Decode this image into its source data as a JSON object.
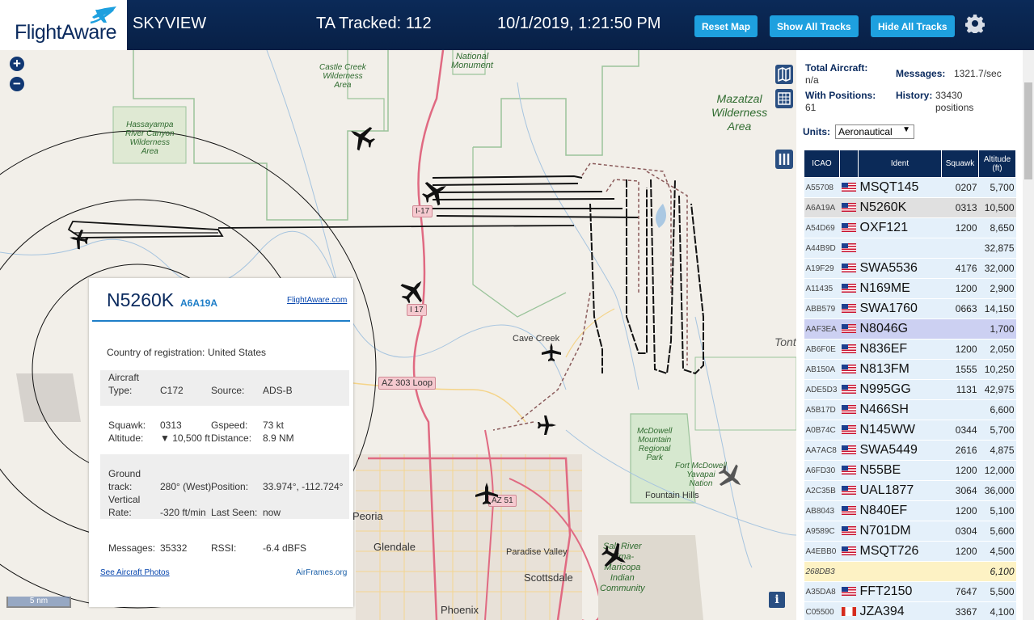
{
  "header": {
    "logo": "FlightAware",
    "title": "SKYVIEW",
    "tracked": "TA Tracked: 112",
    "datetime": "10/1/2019, 1:21:50 PM",
    "buttons": {
      "reset": "Reset Map",
      "show_all": "Show All Tracks",
      "hide_all": "Hide All Tracks"
    }
  },
  "map": {
    "labels": {
      "castle_creek": "Castle Creek\nWilderness\nArea",
      "hassayampa": "Hassayampa\nRiver Canyon\nWilderness\nArea",
      "national_monument": "National\nMonument",
      "mazatzal": "Mazatzal\nWilderness\nArea",
      "cave_creek": "Cave Creek",
      "mcdowell": "McDowell\nMountain\nRegional\nPark",
      "fort_mcdowell": "Fort McDowell\nYavapai\nNation",
      "fountain_hills": "Fountain Hills",
      "peoria": "Peoria",
      "glendale": "Glendale",
      "paradise_valley": "Paradise Valley",
      "scottsdale": "Scottsdale",
      "phoenix": "Phoenix",
      "salt_river": "Salt River\nPima-\nMaricopa\nIndian\nCommunity",
      "tonto": "Tont"
    },
    "roads": {
      "i17_top": "I-17",
      "i17": "I 17",
      "az303": "AZ 303 Loop",
      "az51": "AZ 51"
    },
    "scale": "5 nm",
    "info": "i"
  },
  "popup": {
    "ident": "N5260K",
    "icao": "A6A19A",
    "link": "FlightAware.com",
    "country_label": "Country of registration:",
    "country": "United States",
    "aircraft_type_label": "Aircraft\nType:",
    "aircraft_type": "C172",
    "source_label": "Source:",
    "source": "ADS-B",
    "squawk_label": "Squawk:",
    "squawk": "0313",
    "altitude_label": "Altitude:",
    "altitude": "▼ 10,500 ft",
    "gspeed_label": "Gspeed:",
    "gspeed": "73 kt",
    "distance_label": "Distance:",
    "distance": "8.9 NM",
    "track_label": "Ground\ntrack:",
    "track": "280° (West)",
    "position_label": "Position:",
    "position": "33.974°, -112.724°",
    "vrate_label": "Vertical\nRate:",
    "vrate": "-320 ft/min",
    "last_seen_label": "Last Seen:",
    "last_seen": "now",
    "messages_label": "Messages:",
    "messages": "35332",
    "rssi_label": "RSSI:",
    "rssi": "-6.4 dBFS",
    "photos_link": "See Aircraft Photos",
    "airframes_link": "AirFrames.org"
  },
  "sidebar": {
    "total_label": "Total Aircraft:",
    "total": "n/a",
    "messages_label": "Messages:",
    "messages": "1321.7/sec",
    "positions_label": "With Positions:",
    "positions": "61",
    "history_label": "History:",
    "history": "33430\npositions",
    "units_label": "Units:",
    "units_value": "Aeronautical",
    "columns": [
      "ICAO",
      "",
      "Ident",
      "Squawk",
      "Altitude\n(ft)"
    ],
    "rows": [
      {
        "icao": "A55708",
        "ident": "MSQT145",
        "squawk": "0207",
        "alt": "5,700",
        "flag": "us"
      },
      {
        "icao": "A6A19A",
        "ident": "N5260K",
        "squawk": "0313",
        "alt": "10,500",
        "flag": "us",
        "state": "sel"
      },
      {
        "icao": "A54D69",
        "ident": "OXF121",
        "squawk": "1200",
        "alt": "8,650",
        "flag": "us"
      },
      {
        "icao": "A44B9D",
        "ident": "",
        "squawk": "",
        "alt": "32,875",
        "flag": "us"
      },
      {
        "icao": "A19F29",
        "ident": "SWA5536",
        "squawk": "4176",
        "alt": "32,000",
        "flag": "us"
      },
      {
        "icao": "A11435",
        "ident": "N169ME",
        "squawk": "1200",
        "alt": "2,900",
        "flag": "us"
      },
      {
        "icao": "ABB579",
        "ident": "SWA1760",
        "squawk": "0663",
        "alt": "14,150",
        "flag": "us"
      },
      {
        "icao": "AAF3EA",
        "ident": "N8046G",
        "squawk": "",
        "alt": "1,700",
        "flag": "us",
        "state": "hi"
      },
      {
        "icao": "AB6F0E",
        "ident": "N836EF",
        "squawk": "1200",
        "alt": "2,050",
        "flag": "us"
      },
      {
        "icao": "AB150A",
        "ident": "N813FM",
        "squawk": "1555",
        "alt": "10,250",
        "flag": "us"
      },
      {
        "icao": "ADE5D3",
        "ident": "N995GG",
        "squawk": "1131",
        "alt": "42,975",
        "flag": "us"
      },
      {
        "icao": "A5B17D",
        "ident": "N466SH",
        "squawk": "",
        "alt": "6,600",
        "flag": "us"
      },
      {
        "icao": "A0B74C",
        "ident": "N145WW",
        "squawk": "0344",
        "alt": "5,700",
        "flag": "us"
      },
      {
        "icao": "AA7AC8",
        "ident": "SWA5449",
        "squawk": "2616",
        "alt": "4,875",
        "flag": "us"
      },
      {
        "icao": "A6FD30",
        "ident": "N55BE",
        "squawk": "1200",
        "alt": "12,000",
        "flag": "us"
      },
      {
        "icao": "A2C35B",
        "ident": "UAL1877",
        "squawk": "3064",
        "alt": "36,000",
        "flag": "us"
      },
      {
        "icao": "AB8043",
        "ident": "N840EF",
        "squawk": "1200",
        "alt": "5,100",
        "flag": "us"
      },
      {
        "icao": "A9589C",
        "ident": "N701DM",
        "squawk": "0304",
        "alt": "5,600",
        "flag": "us"
      },
      {
        "icao": "A4EBB0",
        "ident": "MSQT726",
        "squawk": "1200",
        "alt": "4,500",
        "flag": "us"
      },
      {
        "icao": "268DB3",
        "ident": "",
        "squawk": "",
        "alt": "6,100",
        "flag": "",
        "state": "nopos"
      },
      {
        "icao": "A35DA8",
        "ident": "FFT2150",
        "squawk": "7647",
        "alt": "5,500",
        "flag": "us"
      },
      {
        "icao": "C05500",
        "ident": "JZA394",
        "squawk": "3367",
        "alt": "4,100",
        "flag": "ca"
      }
    ]
  }
}
